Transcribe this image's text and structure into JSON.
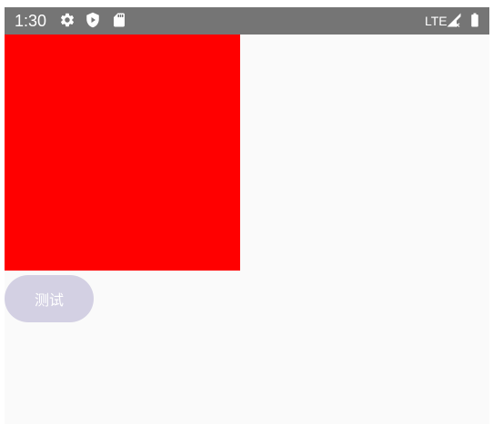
{
  "status_bar": {
    "time": "1:30",
    "network": "LTE",
    "icons": [
      "gear-icon",
      "shield-play-icon",
      "sd-card-icon",
      "signal-icon",
      "battery-icon"
    ],
    "background_color": "#757575"
  },
  "content": {
    "red_view_color": "#ff0000",
    "test_button": {
      "label": "测试",
      "background_color": "#d3d0e3"
    }
  }
}
